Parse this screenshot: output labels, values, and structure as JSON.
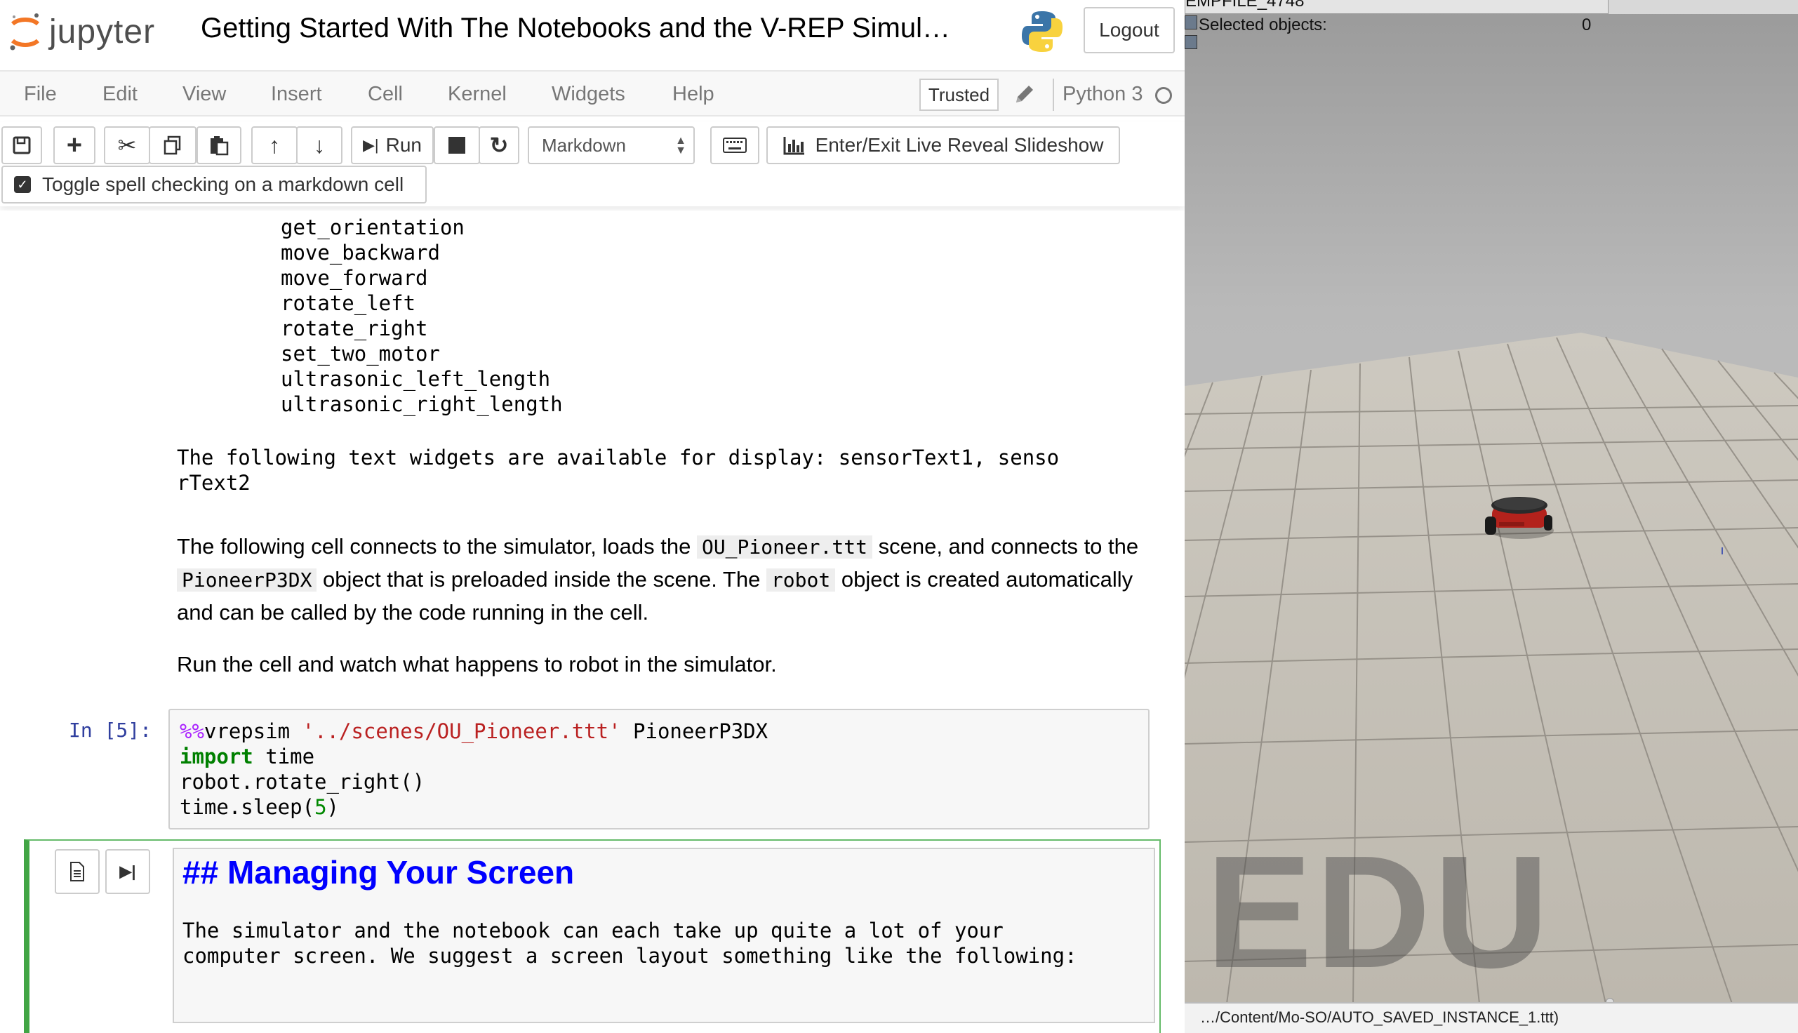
{
  "header": {
    "logo_text": "jupyter",
    "notebook_title": "Getting Started With The Notebooks and the V-REP Simul…",
    "logout_label": "Logout"
  },
  "menu": {
    "items": [
      "File",
      "Edit",
      "View",
      "Insert",
      "Cell",
      "Kernel",
      "Widgets",
      "Help"
    ],
    "trusted_label": "Trusted",
    "kernel_name": "Python 3"
  },
  "toolbar": {
    "run_label": "Run",
    "cell_type": "Markdown",
    "slideshow_label": "Enter/Exit Live Reveal Slideshow",
    "spell_label": "Toggle spell checking on a markdown cell"
  },
  "notebook": {
    "method_list": [
      "get_orientation",
      "move_backward",
      "move_forward",
      "rotate_left",
      "rotate_right",
      "set_two_motor",
      "ultrasonic_left_length",
      "ultrasonic_right_length"
    ],
    "widgets_text_line1": "The following text widgets are available for display: sensorText1, senso",
    "widgets_text_line2": "rText2",
    "para1": {
      "t1": "The following cell connects to the simulator, loads the ",
      "c1": "OU_Pioneer.ttt",
      "t2": " scene, and connects to the ",
      "c2": "PioneerP3DX",
      "t3": " object that is preloaded inside the scene. The ",
      "c3": "robot",
      "t4": " object is created automatically and can be called by the code running in the cell."
    },
    "para2": "Run the cell and watch what happens to robot in the simulator.",
    "code_cell": {
      "prompt": "In [5]:",
      "magic": "%%",
      "magic_name": "vrepsim",
      "scene_arg": "'../scenes/OU_Pioneer.ttt'",
      "robot_arg": "PioneerP3DX",
      "kw_import": "import",
      "import_mod": "time",
      "line3": "robot.rotate_right()",
      "sleep_pre": "time.sleep(",
      "sleep_num": "5",
      "sleep_post": ")"
    },
    "md_cell": {
      "heading": "## Managing Your Screen",
      "body_line1": "The simulator and the notebook can each take up quite a lot of your",
      "body_line2": "computer screen. We suggest a screen layout something like the following:"
    }
  },
  "vrep": {
    "window_tab": "EMPFILE_4748",
    "selected_label": "Selected objects:",
    "selected_count": "0",
    "watermark": "EDU",
    "status_text": "…/Content/Mo-SO/AUTO_SAVED_INSTANCE_1.ttt)"
  },
  "colors": {
    "jupyter_orange": "#f37726",
    "selected_cell_border": "#42a545",
    "heading_blue": "#0000ff",
    "prompt_blue": "#303f9f"
  }
}
